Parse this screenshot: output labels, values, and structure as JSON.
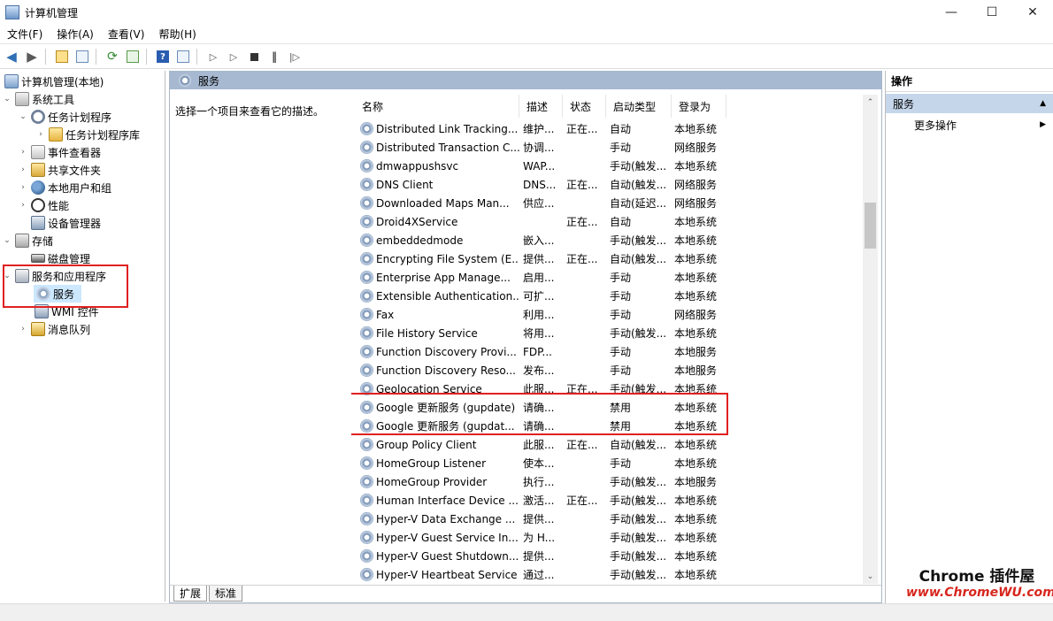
{
  "window": {
    "title": "计算机管理",
    "minimize_glyph": "—",
    "maximize_glyph": "☐",
    "close_glyph": "✕"
  },
  "menu": [
    "文件(F)",
    "操作(A)",
    "查看(V)",
    "帮助(H)"
  ],
  "toolbar": {
    "icons": [
      "back-icon",
      "forward-icon",
      "up-folder-icon",
      "show-hide-tree-icon",
      "refresh-icon",
      "export-icon",
      "help-icon",
      "properties-icon",
      "start-service-icon",
      "start-service-alt-icon",
      "stop-service-icon",
      "pause-service-icon",
      "restart-service-icon"
    ]
  },
  "tree": {
    "root": "计算机管理(本地)",
    "system_tools": "系统工具",
    "task_scheduler": "任务计划程序",
    "task_library": "任务计划程序库",
    "event_viewer": "事件查看器",
    "shared_folders": "共享文件夹",
    "local_users": "本地用户和组",
    "performance": "性能",
    "device_manager": "设备管理器",
    "storage": "存储",
    "disk_mgmt": "磁盘管理",
    "services_apps": "服务和应用程序",
    "services": "服务",
    "wmi": "WMI 控件",
    "msg_queue": "消息队列"
  },
  "middle": {
    "header": "服务",
    "description": "选择一个项目来查看它的描述。",
    "columns": {
      "name": "名称",
      "desc": "描述",
      "status": "状态",
      "startup": "启动类型",
      "logon": "登录为"
    },
    "rows": [
      {
        "name": "Distributed Link Tracking...",
        "desc": "维护...",
        "status": "正在...",
        "startup": "自动",
        "logon": "本地系统"
      },
      {
        "name": "Distributed Transaction C...",
        "desc": "协调...",
        "status": "",
        "startup": "手动",
        "logon": "网络服务"
      },
      {
        "name": "dmwappushsvc",
        "desc": "WAP...",
        "status": "",
        "startup": "手动(触发...",
        "logon": "本地系统"
      },
      {
        "name": "DNS Client",
        "desc": "DNS...",
        "status": "正在...",
        "startup": "自动(触发...",
        "logon": "网络服务"
      },
      {
        "name": "Downloaded Maps Man...",
        "desc": "供应...",
        "status": "",
        "startup": "自动(延迟...",
        "logon": "网络服务"
      },
      {
        "name": "Droid4XService",
        "desc": "",
        "status": "正在...",
        "startup": "自动",
        "logon": "本地系统"
      },
      {
        "name": "embeddedmode",
        "desc": "嵌入...",
        "status": "",
        "startup": "手动(触发...",
        "logon": "本地系统"
      },
      {
        "name": "Encrypting File System (E...",
        "desc": "提供...",
        "status": "正在...",
        "startup": "自动(触发...",
        "logon": "本地系统"
      },
      {
        "name": "Enterprise App Manage...",
        "desc": "启用...",
        "status": "",
        "startup": "手动",
        "logon": "本地系统"
      },
      {
        "name": "Extensible Authentication...",
        "desc": "可扩...",
        "status": "",
        "startup": "手动",
        "logon": "本地系统"
      },
      {
        "name": "Fax",
        "desc": "利用...",
        "status": "",
        "startup": "手动",
        "logon": "网络服务"
      },
      {
        "name": "File History Service",
        "desc": "将用...",
        "status": "",
        "startup": "手动(触发...",
        "logon": "本地系统"
      },
      {
        "name": "Function Discovery Provi...",
        "desc": "FDP...",
        "status": "",
        "startup": "手动",
        "logon": "本地服务"
      },
      {
        "name": "Function Discovery Reso...",
        "desc": "发布...",
        "status": "",
        "startup": "手动",
        "logon": "本地服务"
      },
      {
        "name": "Geolocation Service",
        "desc": "此服...",
        "status": "正在...",
        "startup": "手动(触发...",
        "logon": "本地系统"
      },
      {
        "name": "Google 更新服务 (gupdate)",
        "desc": "请确...",
        "status": "",
        "startup": "禁用",
        "logon": "本地系统"
      },
      {
        "name": "Google 更新服务 (gupdat...",
        "desc": "请确...",
        "status": "",
        "startup": "禁用",
        "logon": "本地系统"
      },
      {
        "name": "Group Policy Client",
        "desc": "此服...",
        "status": "正在...",
        "startup": "自动(触发...",
        "logon": "本地系统"
      },
      {
        "name": "HomeGroup Listener",
        "desc": "使本...",
        "status": "",
        "startup": "手动",
        "logon": "本地系统"
      },
      {
        "name": "HomeGroup Provider",
        "desc": "执行...",
        "status": "",
        "startup": "手动(触发...",
        "logon": "本地服务"
      },
      {
        "name": "Human Interface Device ...",
        "desc": "激活...",
        "status": "正在...",
        "startup": "手动(触发...",
        "logon": "本地系统"
      },
      {
        "name": "Hyper-V Data Exchange ...",
        "desc": "提供...",
        "status": "",
        "startup": "手动(触发...",
        "logon": "本地系统"
      },
      {
        "name": "Hyper-V Guest Service In...",
        "desc": "为 H...",
        "status": "",
        "startup": "手动(触发...",
        "logon": "本地系统"
      },
      {
        "name": "Hyper-V Guest Shutdown...",
        "desc": "提供...",
        "status": "",
        "startup": "手动(触发...",
        "logon": "本地系统"
      },
      {
        "name": "Hyper-V Heartbeat Service",
        "desc": "通过...",
        "status": "",
        "startup": "手动(触发...",
        "logon": "本地系统"
      }
    ],
    "tabs": [
      "扩展",
      "标准"
    ]
  },
  "actions": {
    "header": "操作",
    "group": "服务",
    "more": "更多操作"
  },
  "watermark": {
    "title": "Chrome 插件屋",
    "url": "www.ChromeWU.com"
  }
}
